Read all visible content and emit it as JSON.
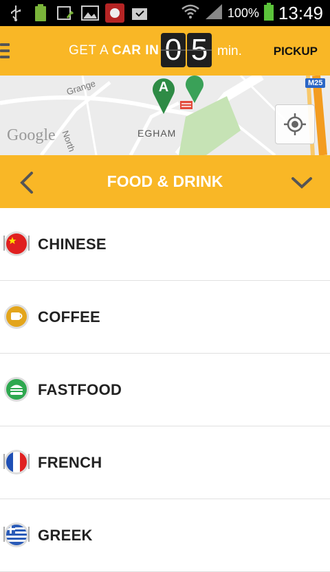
{
  "status_bar": {
    "battery_percent": "100%",
    "time": "13:49",
    "notifications": [
      "usb-icon",
      "battery-full-icon",
      "download-icon",
      "image-icon",
      "app-icon",
      "task-icon"
    ]
  },
  "header": {
    "get_prefix": "GET A",
    "car_in": "CAR IN",
    "digit_1": "0",
    "digit_2": "5",
    "unit": "min.",
    "pickup_label": "PICKUP"
  },
  "map": {
    "label_town": "EGHAM",
    "label_street_1": "Grange",
    "label_street_2": "North",
    "motorway": "M25",
    "marker_a": "A",
    "logo_text": "Google"
  },
  "category": {
    "title": "FOOD & DRINK"
  },
  "items": [
    {
      "label": "CHINESE",
      "icon": "china-flag-icon"
    },
    {
      "label": "COFFEE",
      "icon": "coffee-icon"
    },
    {
      "label": "FASTFOOD",
      "icon": "burger-icon"
    },
    {
      "label": "FRENCH",
      "icon": "france-flag-icon"
    },
    {
      "label": "GREEK",
      "icon": "greece-flag-icon"
    }
  ],
  "colors": {
    "accent": "#f9b726",
    "status_bar": "#000000",
    "text_dark": "#222222"
  }
}
